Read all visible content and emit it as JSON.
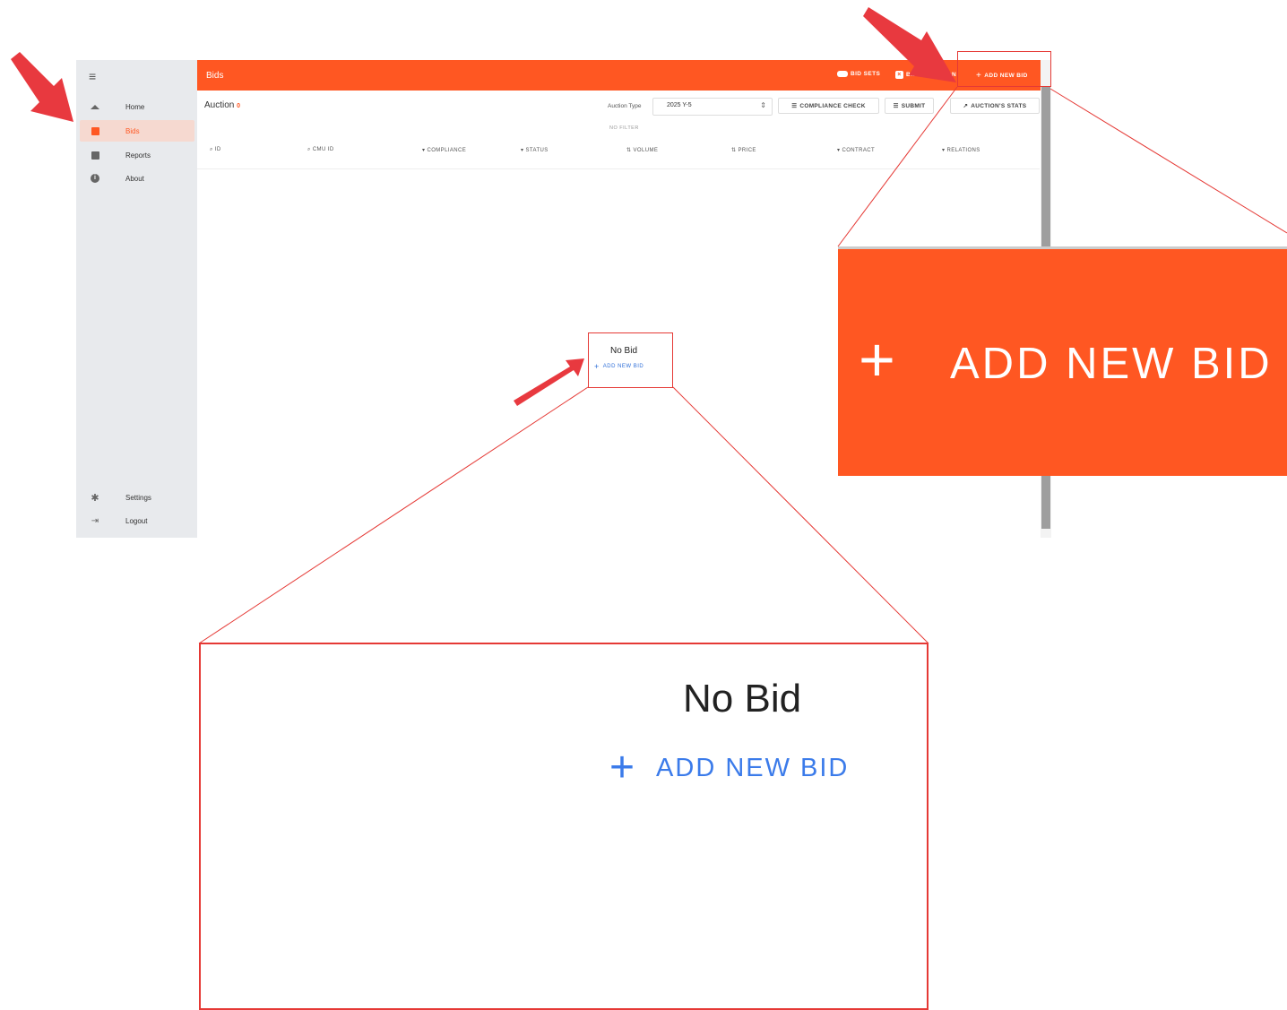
{
  "sidebar": {
    "menu_icon": "menu-icon",
    "items": [
      {
        "label": "Home",
        "icon": "home-icon"
      },
      {
        "label": "Bids",
        "icon": "bids-icon",
        "active": true
      },
      {
        "label": "Reports",
        "icon": "reports-icon"
      },
      {
        "label": "About",
        "icon": "info-icon"
      }
    ],
    "bottom_items": [
      {
        "label": "Settings",
        "icon": "gear-icon"
      },
      {
        "label": "Logout",
        "icon": "logout-icon"
      }
    ]
  },
  "appbar": {
    "title": "Bids",
    "actions": [
      {
        "label": "BID SETS",
        "icon": "bid-sets-icon"
      },
      {
        "label": "BID EXCLUSION",
        "icon": "exclusion-icon"
      },
      {
        "label": "ADD NEW BID",
        "icon": "plus-icon"
      }
    ]
  },
  "toolbar": {
    "auction_label": "Auction",
    "auction_count": "0",
    "auction_type_label": "Auction Type",
    "auction_type_value": "2025 Y-5",
    "compliance_check": "COMPLIANCE CHECK",
    "submit": "SUBMIT",
    "auction_stats": "AUCTION'S STATS",
    "no_filter": "NO FILTER"
  },
  "columns": [
    {
      "label": "ID",
      "icon": "search-icon"
    },
    {
      "label": "CMU ID",
      "icon": "search-icon"
    },
    {
      "label": "COMPLIANCE",
      "icon": "filter-icon"
    },
    {
      "label": "STATUS",
      "icon": "filter-icon"
    },
    {
      "label": "VOLUME",
      "icon": "sort-icon"
    },
    {
      "label": "PRICE",
      "icon": "sort-icon"
    },
    {
      "label": "CONTRACT",
      "icon": "filter-icon"
    },
    {
      "label": "RELATIONS",
      "icon": "filter-icon"
    }
  ],
  "empty_state": {
    "title": "No Bid",
    "add_label": "ADD NEW BID"
  },
  "zoom_callouts": {
    "top_right_label": "ADD NEW BID",
    "bottom_title": "No Bid",
    "bottom_add_label": "ADD NEW BID"
  },
  "colors": {
    "accent": "#ff5722",
    "link_blue": "#2f6fd8",
    "annotation_red": "#e53935"
  }
}
